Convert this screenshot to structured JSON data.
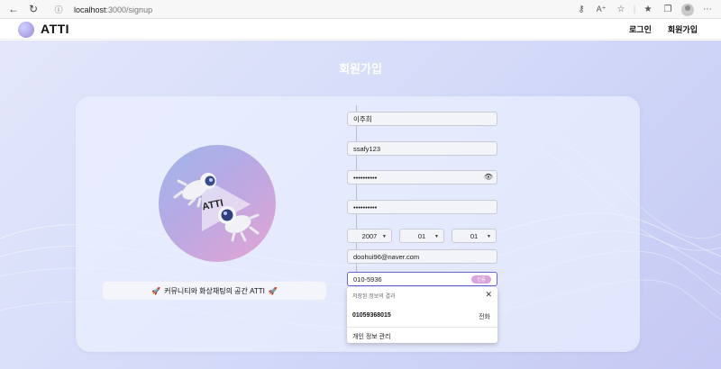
{
  "browser": {
    "url_host": "localhost",
    "url_path": ":3000/signup"
  },
  "app": {
    "logo_text": "ATTI",
    "nav": {
      "login": "로그인",
      "signup": "회원가입"
    }
  },
  "page": {
    "title": "회원가입",
    "illustration_label": "ATTI",
    "caption": "커뮤니티와 화상채팅의 공간 ATTI"
  },
  "form": {
    "name": "이주희",
    "user_id": "ssafy123",
    "password": "••••••••••",
    "password_confirm": "••••••••••",
    "birth_year": "2007",
    "birth_month": "01",
    "birth_day": "01",
    "email": "doohui96@naver.com",
    "phone": "010-5936",
    "phone_confirm_label": "인증"
  },
  "autofill": {
    "header": "저장된 정보의 결과",
    "suggestion_value": "01059368015",
    "suggestion_type": "전화",
    "manage": "개인 정보 관리"
  },
  "colors": {
    "accent": "#6a62d9",
    "confirm_button": "#d9a3dd"
  }
}
